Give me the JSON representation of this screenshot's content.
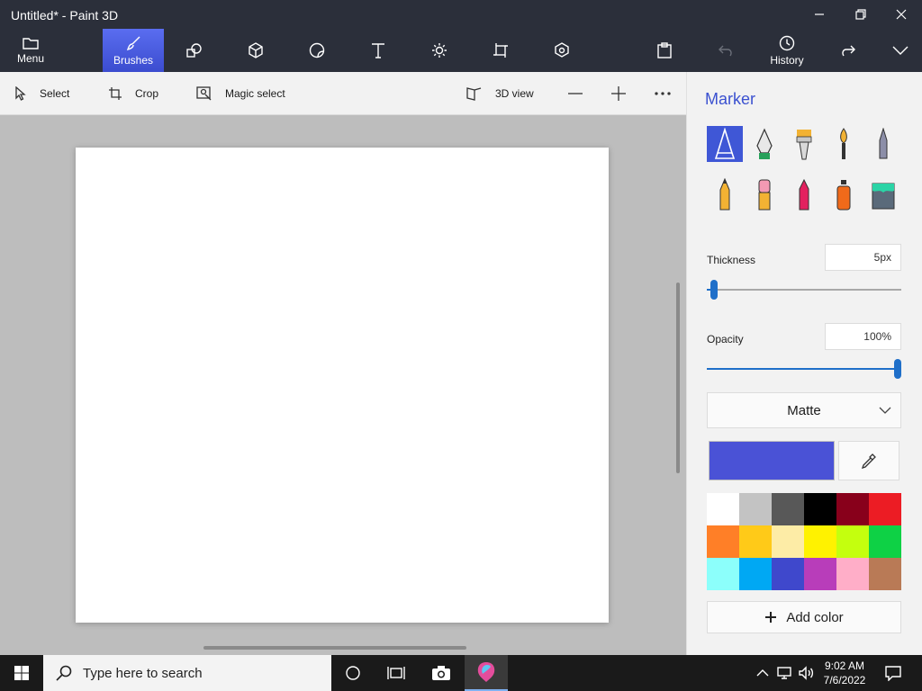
{
  "window": {
    "title": "Untitled* - Paint 3D"
  },
  "ribbon": {
    "menu_label": "Menu",
    "brushes_label": "Brushes",
    "history_label": "History"
  },
  "toolbar": {
    "select_label": "Select",
    "crop_label": "Crop",
    "magic_select_label": "Magic select",
    "view3d_label": "3D view"
  },
  "panel": {
    "title": "Marker",
    "brushes": [
      {
        "name": "marker",
        "active": true
      },
      {
        "name": "calligraphy-pen"
      },
      {
        "name": "oil-brush"
      },
      {
        "name": "watercolor"
      },
      {
        "name": "pixel-pen"
      },
      {
        "name": "pencil"
      },
      {
        "name": "eraser"
      },
      {
        "name": "crayon"
      },
      {
        "name": "spray-can"
      },
      {
        "name": "fill-bucket"
      }
    ],
    "thickness_label": "Thickness",
    "thickness_value": "5px",
    "thickness_level": 0.02,
    "opacity_label": "Opacity",
    "opacity_value": "100%",
    "opacity_level": 1.0,
    "finish_selected": "Matte",
    "current_color": "#4a52d6",
    "palette": [
      "#ffffff",
      "#c3c3c3",
      "#585858",
      "#000000",
      "#88001b",
      "#ec1c24",
      "#ff7f27",
      "#ffca18",
      "#fdeca6",
      "#fff200",
      "#c4ff0e",
      "#0ed145",
      "#8cfffb",
      "#00a8f3",
      "#3f48cc",
      "#b83dba",
      "#ffaec8",
      "#b97a56"
    ],
    "add_color_label": "Add color"
  },
  "taskbar": {
    "search_placeholder": "Type here to search",
    "time": "9:02 AM",
    "date": "7/6/2022"
  }
}
